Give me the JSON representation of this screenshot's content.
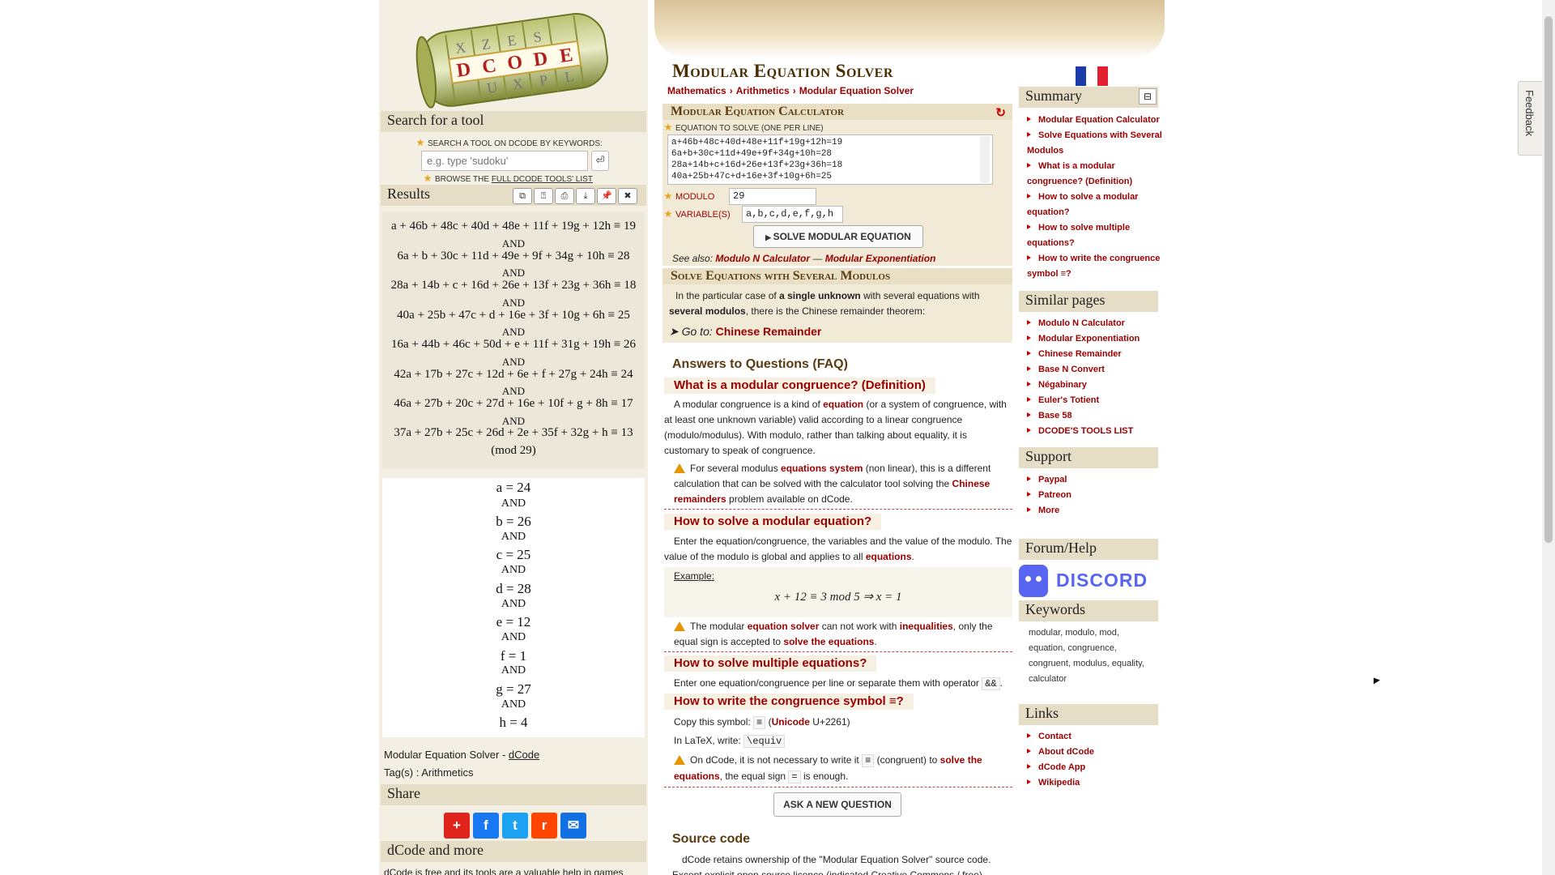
{
  "logo": {
    "letters": [
      "X",
      "Z",
      "E",
      "S",
      "D",
      "C",
      "O",
      "D",
      "E",
      "U",
      "X",
      "P",
      "L"
    ]
  },
  "sidebar": {
    "search_title": "Search for a tool",
    "search_label": "SEARCH A TOOL ON DCODE BY KEYWORDS:",
    "search_placeholder": "e.g. type 'sudoku'",
    "search_go": "⏎",
    "browse_prefix": "BROWSE THE ",
    "browse_link": "FULL DCODE TOOLS' LIST",
    "results_title": "Results",
    "result_buttons": [
      "⧉",
      "⍰",
      "⎙",
      "⤓",
      "✖"
    ],
    "equations": [
      "a + 46b + 48c + 40d + 48e + 11f + 19g + 12h ≡ 19",
      "6a + b + 30c + 11d + 49e + 9f + 34g + 10h ≡ 28",
      "28a + 14b + c + 16d + 26e + 13f + 23g + 36h ≡ 18",
      "40a + 25b + 47c + d + 16e + 3f + 10g + 6h ≡ 25",
      "16a + 44b + 46c + 50d + e + 11f + 31g + 19h ≡ 26",
      "42a + 17b + 27c + 12d + 6e + f + 27g + 24h ≡ 24",
      "46a + 27b + 20c + 27d + 16e + 10f + g + 8h ≡ 17",
      "37a + 27b + 25c + 26d + 2e + 35f + 32g + h ≡ 13"
    ],
    "and": "AND",
    "mod_line": "(mod  29)",
    "solutions": [
      "a = 24",
      "b = 26",
      "c = 25",
      "d = 28",
      "e = 12",
      "f = 1",
      "g = 27",
      "h = 4"
    ],
    "cite_prefix": "Modular Equation Solver - ",
    "cite_link": "dCode",
    "tags": "Tag(s) : Arithmetics",
    "share_title": "Share",
    "share_icons": [
      {
        "name": "add",
        "glyph": "+",
        "color": "#e0241c"
      },
      {
        "name": "facebook",
        "glyph": "f",
        "color": "#1877f2"
      },
      {
        "name": "twitter",
        "glyph": "t",
        "color": "#1da1f2"
      },
      {
        "name": "reddit",
        "glyph": "r",
        "color": "#ff4500"
      },
      {
        "name": "email",
        "glyph": "✉",
        "color": "#1170e4"
      }
    ],
    "more_title": "dCode and more",
    "more_text": "dCode is free and its tools are a valuable help in games"
  },
  "main": {
    "title": "Modular Equation Solver",
    "breadcrumb": [
      "Mathematics",
      "Arithmetics",
      "Modular Equation Solver"
    ],
    "calc_title": "Modular Equation Calculator",
    "eq_label": "EQUATION TO SOLVE (ONE PER LINE)",
    "eq_text": "a+46b+48c+40d+48e+11f+19g+12h=19\n6a+b+30c+11d+49e+9f+34g+10h=28\n28a+14b+c+16d+26e+13f+23g+36h=18\n40a+25b+47c+d+16e+3f+10g+6h=25",
    "modulo_label": "MODULO",
    "modulo_value": "29",
    "var_label": "VARIABLE(S)",
    "var_value": "a,b,c,d,e,f,g,h",
    "solve_button": "SOLVE MODULAR EQUATION",
    "see_also": "See also:",
    "see_also_links": [
      "Modulo N Calculator",
      "Modular Exponentiation"
    ],
    "see_also_sep": " — ",
    "several_title": "Solve Equations with Several Modulos",
    "several_text_1": "In the particular case of ",
    "several_bold_1": "a single unknown",
    "several_text_2": " with several equations with ",
    "several_bold_2": "several modulos",
    "several_text_3": ", there is the Chinese remainder theorem:",
    "goto_label": "➤ Go to: ",
    "goto_link": "Chinese Remainder",
    "faq_title": "Answers to Questions (FAQ)",
    "q1": "What is a modular congruence? (Definition)",
    "a1_1": "A modular congruence is a kind of ",
    "a1_link": "equation",
    "a1_2": " (or a system of congruence, with at least one unknown variable) valid according to a linear congruence (modulo/modulus). With modulo, rather than talking about equality, it is customary to speak of congruence.",
    "w1_1": "For several modulus ",
    "w1_link1": "equations system",
    "w1_2": " (non linear), this is a different calculation that can be solved with the calculator tool solving the ",
    "w1_link2": "Chinese remainders",
    "w1_3": " problem available on dCode.",
    "q2": "How to solve a modular equation?",
    "a2_1": "Enter the equation/congruence, the variables and the value of the modulo. The value of the modulo is global and applies to all ",
    "a2_link": "equations",
    "a2_2": ".",
    "example_label": "Example:",
    "example_formula": "x + 12 ≡ 3   mod 5 ⇒ x = 1",
    "w2_1": "The modular ",
    "w2_link1": "equation solver",
    "w2_2": " can not work with ",
    "w2_link2": "inequalities",
    "w2_3": ", only the equal sign is accepted to ",
    "w2_link3": "solve the equations",
    "w2_4": ".",
    "q3": "How to solve multiple equations?",
    "a3": "Enter one equation/congruence per line or separate them with operator ",
    "a3_code": "&&",
    "a3_end": ".",
    "q4": "How to write the congruence symbol ≡?",
    "a4_1": "Copy this symbol: ",
    "a4_code": "≡",
    "a4_2": " (",
    "a4_link": "Unicode",
    "a4_3": " U+2261)",
    "a4_latex": "In LaTeX, write: ",
    "a4_latex_code": "\\equiv",
    "w3_1": "On dCode, it is not necessary to write it ",
    "w3_code1": "≡",
    "w3_2": " (congruent) to ",
    "w3_link": "solve the equations",
    "w3_3": ", the equal sign ",
    "w3_code2": "=",
    "w3_4": " is enough.",
    "ask_button": "ASK A NEW QUESTION",
    "source_title": "Source code",
    "source_text": "dCode retains ownership of the \"Modular Equation Solver\" source code.",
    "source_text2": "Except explicit open source licence (indicated Creative Commons / free)"
  },
  "rightbar": {
    "summary_title": "Summary",
    "summary_toggle": "⊟",
    "summary_items": [
      "Modular Equation Calculator",
      "Solve Equations with Several Modulos",
      "What is a modular congruence? (Definition)",
      "How to solve a modular equation?",
      "How to solve multiple equations?",
      "How to write the congruence symbol ≡?"
    ],
    "similar_title": "Similar pages",
    "similar_items": [
      "Modulo N Calculator",
      "Modular Exponentiation",
      "Chinese Remainder",
      "Base N Convert",
      "Négabinary",
      "Euler's Totient",
      "Base 58",
      "DCODE'S TOOLS LIST"
    ],
    "support_title": "Support",
    "support_items": [
      "Paypal",
      "Patreon",
      "More"
    ],
    "forum_title": "Forum/Help",
    "discord_label": "DISCORD",
    "keywords_title": "Keywords",
    "keywords": "modular, modulo, mod, equation, congruence, congruent, modulus, equality, calculator",
    "links_title": "Links",
    "links_items": [
      "Contact",
      "About dCode",
      "dCode App",
      "Wikipedia"
    ]
  },
  "feedback": "Feedback",
  "colors": {
    "accent": "#9b0000",
    "panel": "#f4efe3",
    "header": "#e5ddc5"
  }
}
